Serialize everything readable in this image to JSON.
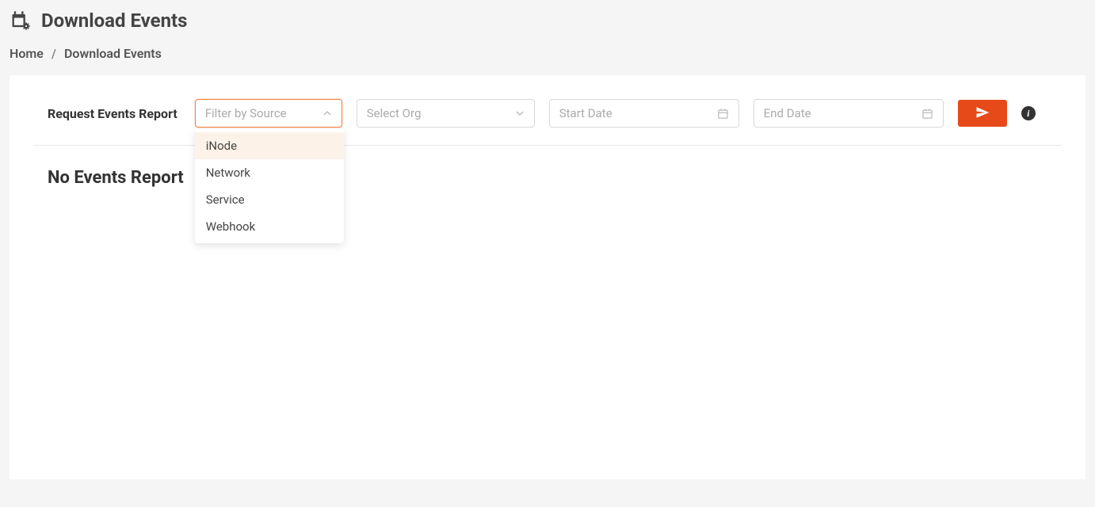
{
  "header": {
    "title": "Download Events"
  },
  "breadcrumb": {
    "home": "Home",
    "current": "Download Events"
  },
  "filters": {
    "label": "Request Events Report",
    "source": {
      "placeholder": "Filter by Source",
      "options": [
        "iNode",
        "Network",
        "Service",
        "Webhook"
      ]
    },
    "org": {
      "placeholder": "Select Org"
    },
    "start_date": {
      "placeholder": "Start Date"
    },
    "end_date": {
      "placeholder": "End Date"
    }
  },
  "empty_state": "No Events Report",
  "info_char": "i"
}
